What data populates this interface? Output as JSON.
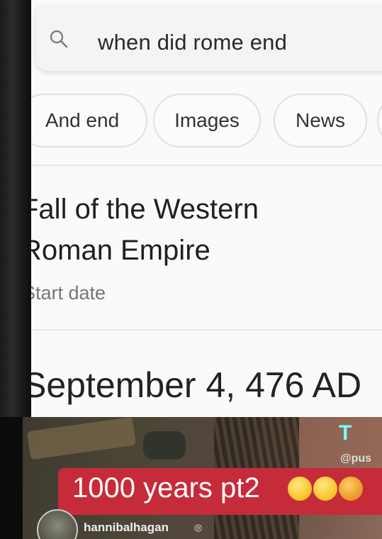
{
  "search": {
    "query": "when did rome end"
  },
  "chips": [
    "And end",
    "Images",
    "News",
    ""
  ],
  "result": {
    "title_line1": "Fall of the Western",
    "title_line2": "Roman Empire",
    "subtitle": "Start date",
    "answer": "September 4, 476 AD"
  },
  "video": {
    "logo": "T",
    "handle": "@pus",
    "caption": "1000 years pt2",
    "username": "hannibalhagan",
    "verified_mark": "◎"
  }
}
